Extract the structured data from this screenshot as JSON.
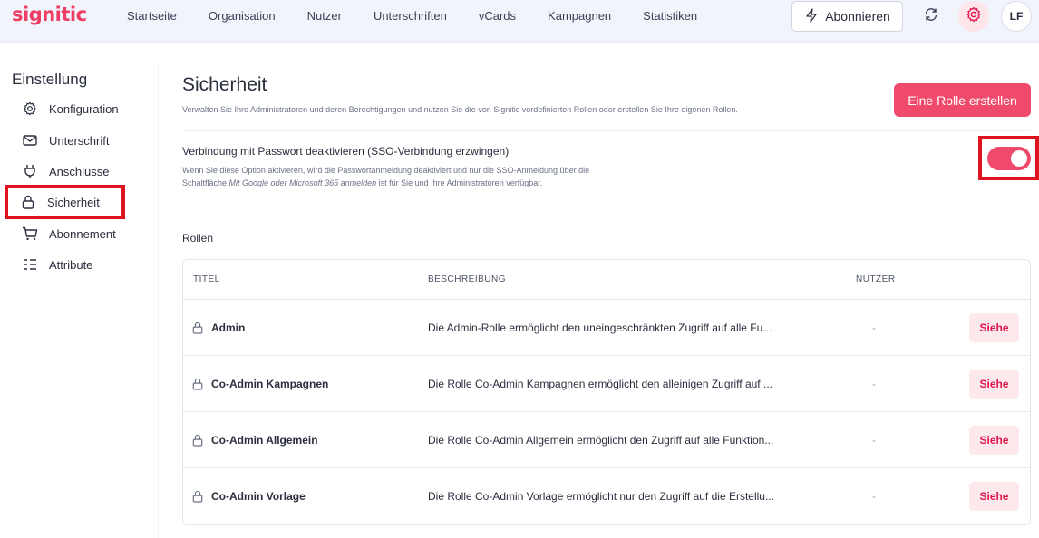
{
  "brand": {
    "logo": "signitic",
    "accent": "#ef4a6c",
    "highlight": "#e0141e"
  },
  "nav": {
    "items": [
      "Startseite",
      "Organisation",
      "Nutzer",
      "Unterschriften",
      "vCards",
      "Kampagnen",
      "Statistiken"
    ],
    "subscribe_label": "Abonnieren",
    "subscribe_icon": "lightning-icon",
    "refresh_icon": "refresh-icon",
    "settings_icon": "gear-icon",
    "avatar_initials": "LF"
  },
  "sidebar": {
    "title": "Einstellung",
    "items": [
      {
        "label": "Konfiguration",
        "icon": "gear-icon"
      },
      {
        "label": "Unterschrift",
        "icon": "envelope-icon"
      },
      {
        "label": "Anschlüsse",
        "icon": "plug-icon"
      },
      {
        "label": "Sicherheit",
        "icon": "lock-icon",
        "active": true
      },
      {
        "label": "Abonnement",
        "icon": "cart-icon"
      },
      {
        "label": "Attribute",
        "icon": "list-icon"
      }
    ]
  },
  "main": {
    "title": "Sicherheit",
    "description": "Verwalten Sie Ihre Administratoren und deren Berechtigungen und nutzen Sie die von Signitic vordefinierten Rollen oder erstellen Sie Ihre eigenen Rollen.",
    "create_button": "Eine Rolle erstellen",
    "sso": {
      "title": "Verbindung mit Passwort deaktivieren (SSO-Verbindung erzwingen)",
      "desc_before": "Wenn Sie diese Option aktivieren, wird die Passwortanmeldung deaktiviert und nur die SSO-Anmeldung über die Schaltfläche ",
      "desc_italic": "Mit Google oder Microsoft 365 anmelden",
      "desc_after": " ist für Sie und Ihre Administratoren verfügbar.",
      "enabled": true
    },
    "roles_label": "Rollen",
    "table": {
      "headers": {
        "title": "TITEL",
        "description": "BESCHREIBUNG",
        "users": "NUTZER"
      },
      "rows": [
        {
          "title": "Admin",
          "description": "Die Admin-Rolle ermöglicht den uneingeschränkten Zugriff auf alle Fu...",
          "users": "-",
          "action": "Siehe"
        },
        {
          "title": "Co-Admin Kampagnen",
          "description": "Die Rolle Co-Admin Kampagnen ermöglicht den alleinigen Zugriff auf ...",
          "users": "-",
          "action": "Siehe"
        },
        {
          "title": "Co-Admin Allgemein",
          "description": "Die Rolle Co-Admin Allgemein ermöglicht den Zugriff auf alle Funktion...",
          "users": "-",
          "action": "Siehe"
        },
        {
          "title": "Co-Admin Vorlage",
          "description": "Die Rolle Co-Admin Vorlage ermöglicht nur den Zugriff auf die Erstellu...",
          "users": "-",
          "action": "Siehe"
        }
      ]
    }
  }
}
